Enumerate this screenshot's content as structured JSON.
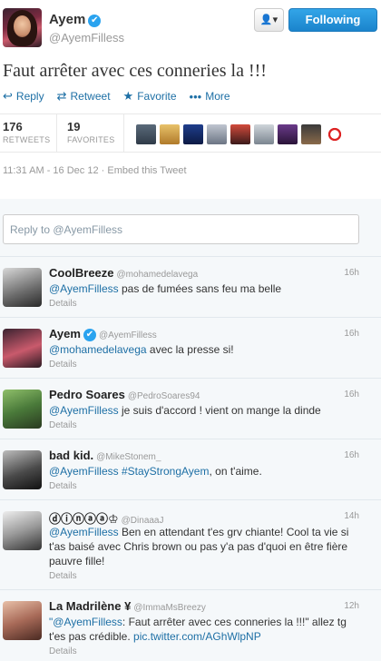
{
  "author": {
    "name": "Ayem",
    "handle": "@AyemFilless",
    "verified_icon": "✔"
  },
  "buttons": {
    "user_menu_icon": "👤▾",
    "follow": "Following"
  },
  "tweet": {
    "text": "Faut arrêter avec ces conneries la !!!",
    "actions": [
      {
        "icon": "↩",
        "label": "Reply"
      },
      {
        "icon": "⇄",
        "label": "Retweet"
      },
      {
        "icon": "★",
        "label": "Favorite"
      },
      {
        "icon": "•••",
        "label": "More"
      }
    ],
    "stats": {
      "retweets_count": "176",
      "retweets_label": "RETWEETS",
      "favorites_count": "19",
      "favorites_label": "FAVORITES"
    },
    "timestamp": "11:31 AM - 16 Dec 12 · Embed this Tweet"
  },
  "reply_placeholder": "Reply to @AyemFilless",
  "replies": [
    {
      "name": "CoolBreeze",
      "handle": "@mohamedelavega",
      "time": "16h",
      "mention": "@AyemFilless",
      "text": " pas de fumées sans feu ma belle",
      "details": "Details"
    },
    {
      "name": "Ayem",
      "handle": "@AyemFilless",
      "time": "16h",
      "mention": "@mohamedelavega",
      "text": " avec la presse si!",
      "details": "Details"
    },
    {
      "name": "Pedro Soares",
      "handle": "@PedroSoares94",
      "time": "16h",
      "mention": "@AyemFilless",
      "text": " je suis d'accord ! vient on mange la dinde",
      "details": "Details"
    },
    {
      "name": "bad kid.",
      "handle": "@MikeStonem_",
      "time": "16h",
      "mention": "@AyemFilless",
      "hashtag": " #StayStrongAyem",
      "text": ", on t'aime.",
      "details": "Details"
    },
    {
      "name": "ⓓⓘⓝⓐⓐ♔",
      "handle": "@DinaaaJ",
      "time": "14h",
      "mention": "@AyemFilless",
      "text": " Ben en attendant t'es grv chiante! Cool ta vie si t'as baisé avec Chris brown ou pas y'a pas d'quoi en être fière pauvre fille!",
      "details": "Details"
    },
    {
      "name": "La Madrilène ¥",
      "handle": "@ImmaMsBreezy",
      "time": "12h",
      "quote_open": "\"",
      "mention": "@AyemFilless",
      "text": ": Faut arrêter avec ces conneries la !!!\" allez tg t'es pas crédible. ",
      "link": "pic.twitter.com/AGhWlpNP",
      "details": "Details"
    }
  ]
}
